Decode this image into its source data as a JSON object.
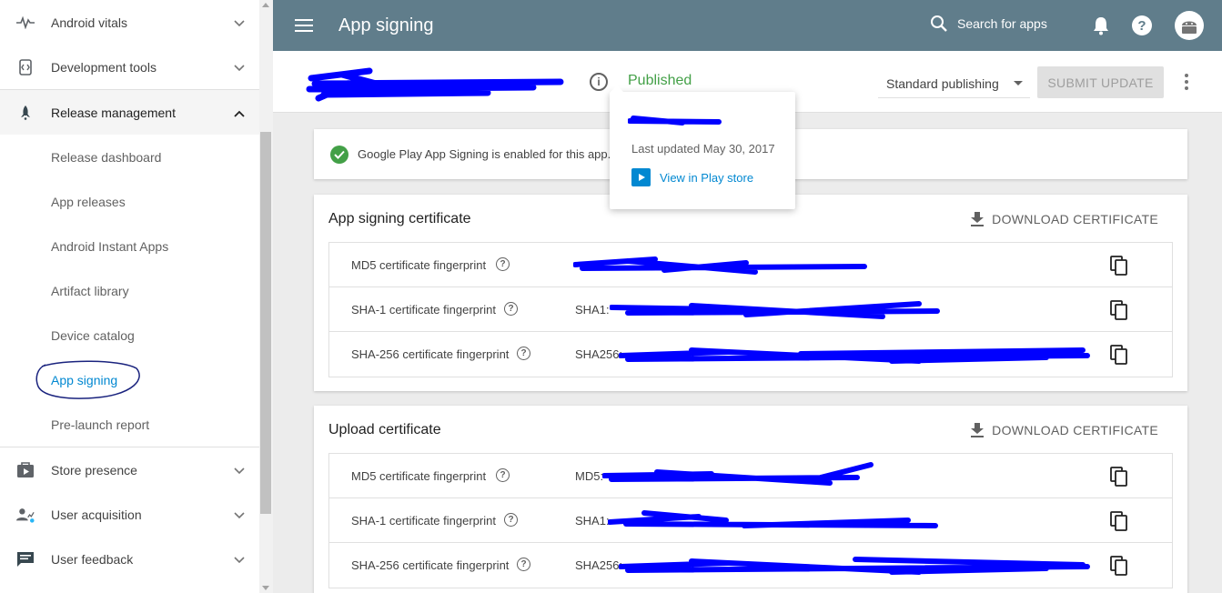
{
  "sidebar": {
    "groups_top": [
      {
        "label": "Android vitals",
        "icon": "pulse-icon"
      },
      {
        "label": "Development tools",
        "icon": "code-icon"
      },
      {
        "label": "Release management",
        "icon": "rocket-icon"
      }
    ],
    "release_items": [
      "Release dashboard",
      "App releases",
      "Android Instant Apps",
      "Artifact library",
      "Device catalog",
      "App signing",
      "Pre-launch report"
    ],
    "groups_bottom": [
      {
        "label": "Store presence",
        "icon": "play-store-icon"
      },
      {
        "label": "User acquisition",
        "icon": "user-acquisition-icon"
      },
      {
        "label": "User feedback",
        "icon": "feedback-icon"
      }
    ]
  },
  "topbar": {
    "title": "App signing",
    "search_placeholder": "Search for apps",
    "color": "#607d8b"
  },
  "subheader": {
    "status": "Published",
    "publishing_mode": "Standard publishing",
    "submit_label": "SUBMIT UPDATE"
  },
  "popup": {
    "last_updated": "Last updated May 30, 2017",
    "view_link": "View in Play store"
  },
  "banner": {
    "text": "Google Play App Signing is enabled for this app."
  },
  "app_signing_cert": {
    "title": "App signing certificate",
    "download_label": "DOWNLOAD CERTIFICATE",
    "rows": [
      {
        "label": "MD5 certificate fingerprint",
        "prefix": ""
      },
      {
        "label": "SHA-1 certificate fingerprint",
        "prefix": "SHA1:"
      },
      {
        "label": "SHA-256 certificate fingerprint",
        "prefix": "SHA256:"
      }
    ]
  },
  "upload_cert": {
    "title": "Upload certificate",
    "download_label": "DOWNLOAD CERTIFICATE",
    "rows": [
      {
        "label": "MD5 certificate fingerprint",
        "prefix": "MD5:"
      },
      {
        "label": "SHA-1 certificate fingerprint",
        "prefix": "SHA1:"
      },
      {
        "label": "SHA-256 certificate fingerprint",
        "prefix": "SHA256:"
      }
    ]
  },
  "colors": {
    "accent": "#0288d1",
    "published": "#43a047",
    "redaction": "#0000ff"
  }
}
